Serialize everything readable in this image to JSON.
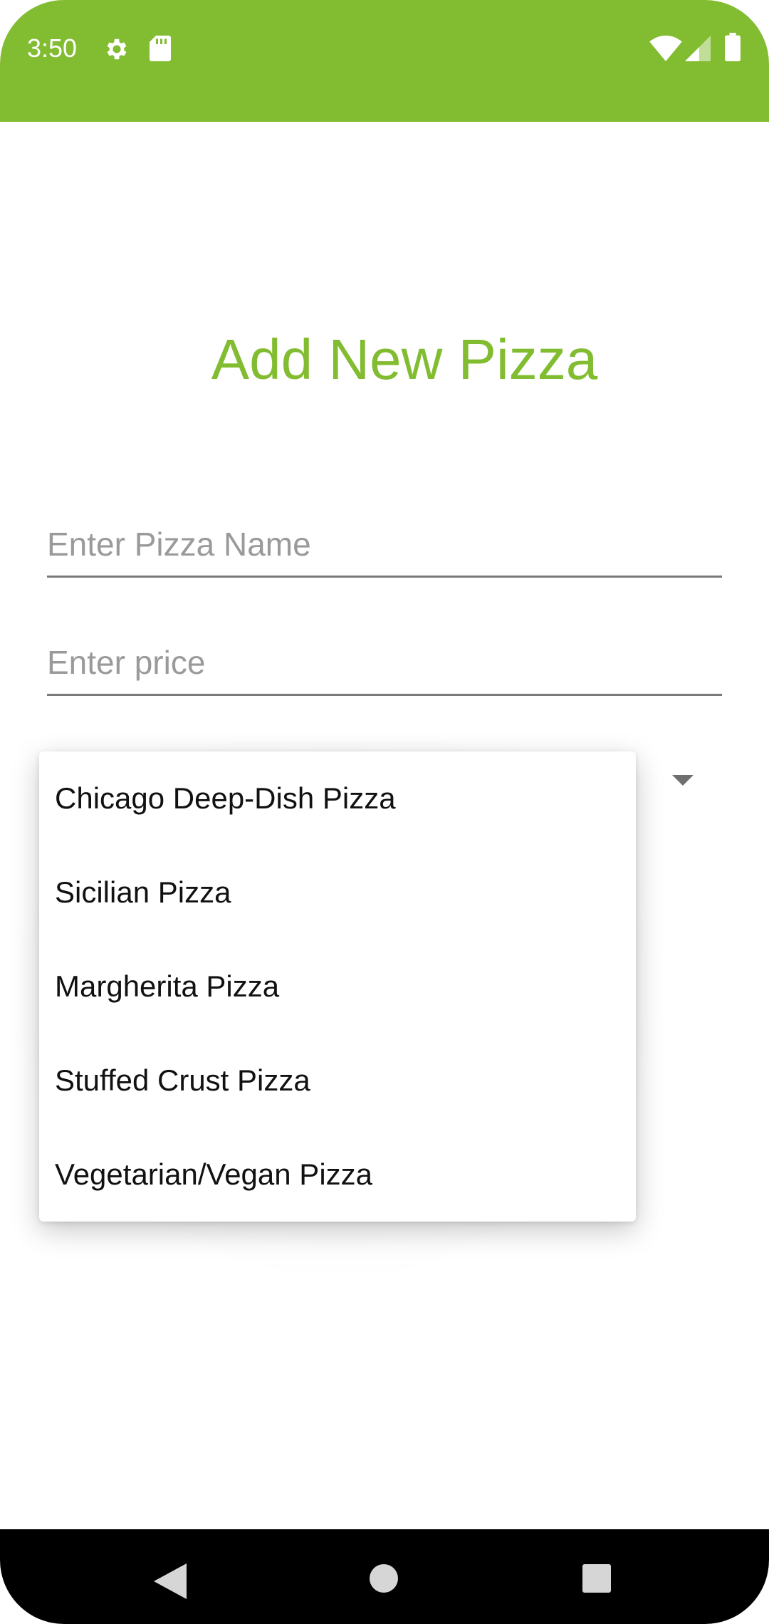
{
  "status_bar": {
    "time": "3:50",
    "icons": [
      "gear-icon",
      "sd-card-icon",
      "wifi-icon",
      "signal-icon",
      "battery-icon"
    ],
    "color": "#82bc31"
  },
  "page": {
    "title": "Add New Pizza"
  },
  "form": {
    "name_placeholder": "Enter Pizza Name",
    "name_value": "",
    "price_placeholder": "Enter price",
    "price_value": ""
  },
  "dropdown": {
    "options": [
      "Chicago Deep-Dish Pizza",
      "Sicilian Pizza",
      "Margherita Pizza",
      "Stuffed Crust Pizza",
      "Vegetarian/Vegan Pizza"
    ]
  },
  "nav_bar": {
    "buttons": [
      "back-icon",
      "home-icon",
      "recents-icon"
    ]
  },
  "colors": {
    "accent": "#82bc31",
    "nav_background": "#000000"
  }
}
